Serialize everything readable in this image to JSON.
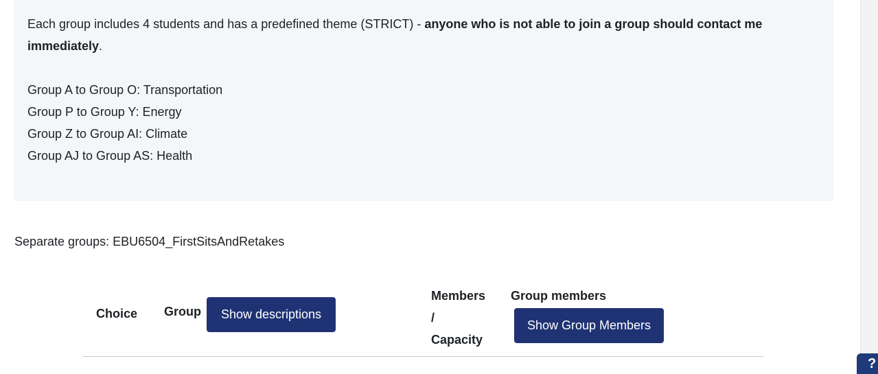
{
  "intro": {
    "text_plain": "Each group includes 4 students and has a predefined theme (STRICT) - ",
    "text_bold": "anyone who is not able to join a group should contact me immediately",
    "text_end": ".",
    "group_lines": [
      "Group A to Group O: Transportation",
      "Group P to Group Y: Energy",
      "Group Z to Group AI: Climate",
      "Group AJ to Group AS: Health"
    ]
  },
  "separate_groups": "Separate groups: EBU6504_FirstSitsAndRetakes",
  "table": {
    "headers": {
      "choice": "Choice",
      "group": "Group",
      "members_line1": "Members",
      "members_line2": "/",
      "members_line3": "Capacity",
      "group_members": "Group members"
    },
    "show_descriptions_label": "Show descriptions",
    "show_group_members_label": "Show Group Members"
  },
  "help": {
    "label": "?"
  },
  "colors": {
    "button_bg": "#1f3374",
    "intro_bg": "#f5f6f8",
    "help_bg": "#1f3a78"
  }
}
